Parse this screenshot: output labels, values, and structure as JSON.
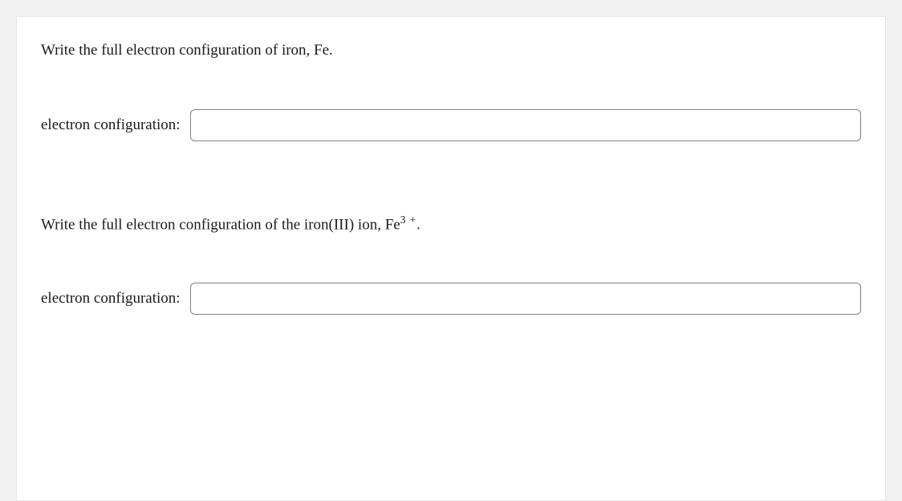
{
  "questions": [
    {
      "prompt_pre": "Write the full electron configuration of iron, Fe.",
      "prompt_sup": "",
      "prompt_post": "",
      "label": "electron configuration:",
      "value": ""
    },
    {
      "prompt_pre": "Write the full electron configuration of the iron(III) ion, Fe",
      "prompt_sup": "3 +",
      "prompt_post": ".",
      "label": "electron configuration:",
      "value": ""
    }
  ]
}
